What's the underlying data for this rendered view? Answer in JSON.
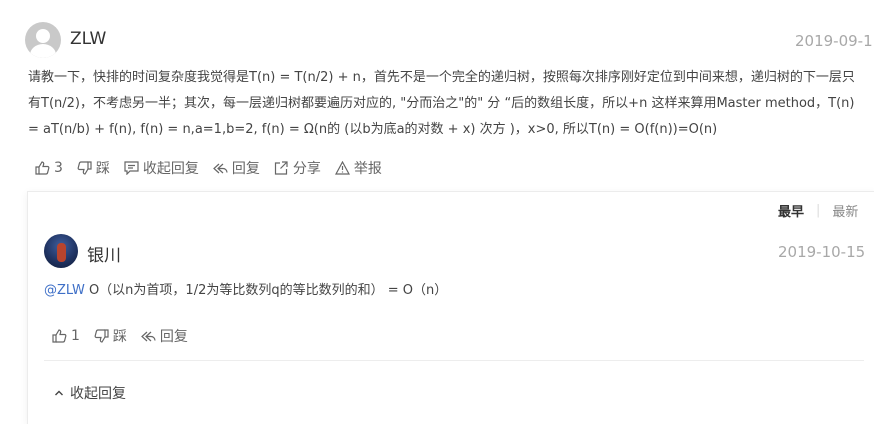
{
  "comment": {
    "username": "ZLW",
    "date": "2019-09-1",
    "text_lines": [
      "请教一下，快排的时间复杂度我觉得是T(n) = T(n/2) + n，首先不是一个完全的递归树，按照每次排序刚好定位到中间来想，递归树的下一层只",
      "有T(n/2)，不考虑另一半；其次，每一层递归树都要遍历对应的, \"分而治之\"的\" 分 “后的数组长度，所以+n 这样来算用Master method，T(n)",
      "= aT(n/b) + f(n), f(n) = n,a=1,b=2, f(n) = Ω(n的 (以b为底a的对数 + x) 次方 )，x>0, 所以T(n) = O(f(n))=O(n)"
    ],
    "actions": {
      "like_count": "3",
      "dislike_label": "踩",
      "collapse_label": "收起回复",
      "reply_label": "回复",
      "share_label": "分享",
      "report_label": "举报"
    }
  },
  "replies": {
    "sort": {
      "earliest": "最早",
      "separator": "|",
      "latest": "最新"
    },
    "items": [
      {
        "username": "银川",
        "date": "2019-10-15",
        "mention": "@ZLW",
        "text": " O（以n为首项，1/2为等比数列q的等比数列的和） = O（n）",
        "like_count": "1",
        "dislike_label": "踩",
        "reply_label": "回复"
      }
    ],
    "collapse_label": "收起回复"
  },
  "icons": {
    "like": "thumbs-up-icon",
    "dislike": "thumbs-down-icon",
    "collapse": "comment-icon",
    "reply": "reply-arrow-icon",
    "share": "share-icon",
    "report": "warning-icon",
    "collapse_caret": "chevron-up-icon"
  },
  "colors": {
    "mention": "#3e6fc7",
    "muted": "#a8a8a8"
  }
}
